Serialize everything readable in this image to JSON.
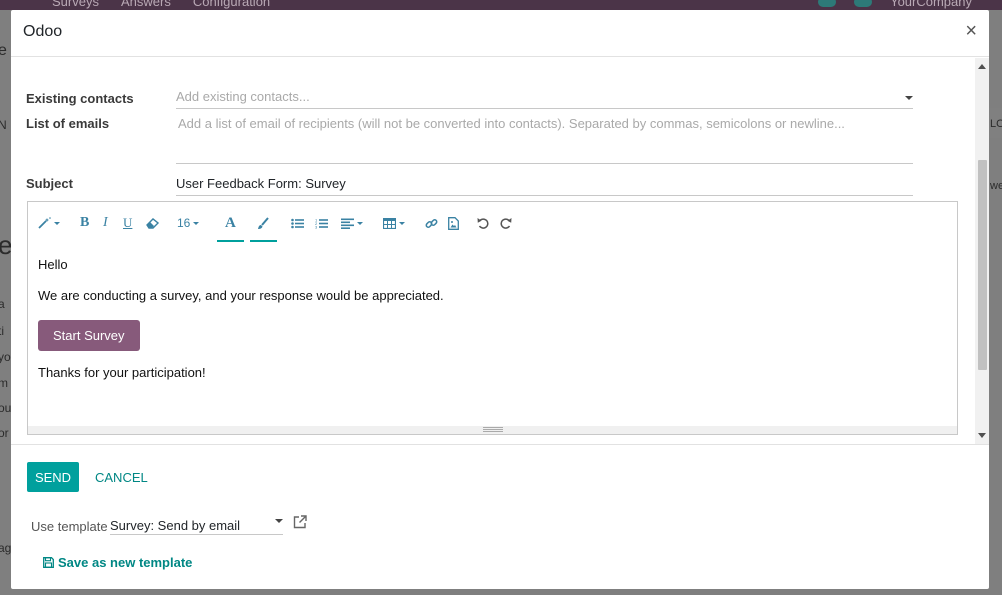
{
  "background": {
    "menu": [
      "Surveys",
      "Answers",
      "Configuration"
    ],
    "company": "YourCompany",
    "left_fragments": [
      "e",
      "N",
      "e",
      "a",
      "ti",
      "yo",
      "m",
      "ou",
      "or",
      "ag"
    ],
    "right_fragments": [
      "LO",
      "we"
    ]
  },
  "dialog": {
    "title": "Odoo",
    "close_glyph": "×"
  },
  "fields": {
    "existing_contacts": {
      "label": "Existing contacts",
      "placeholder": "Add existing contacts..."
    },
    "emails": {
      "label": "List of emails",
      "placeholder": "Add a list of email of recipients (will not be converted into contacts). Separated by commas, semicolons or newline..."
    },
    "subject": {
      "label": "Subject",
      "value": "User Feedback Form: Survey"
    }
  },
  "toolbar": {
    "font_size": "16",
    "font_color_glyph": "A"
  },
  "body": {
    "greeting": "Hello",
    "message": "We are conducting a survey, and your response would be appreciated.",
    "button_label": "Start Survey",
    "closing": "Thanks for your participation!"
  },
  "footer": {
    "send_label": "SEND",
    "cancel_label": "CANCEL",
    "use_template_label": "Use template",
    "template_value": "Survey: Send by email",
    "save_template_label": "Save as new template"
  },
  "colors": {
    "primary": "#00a09d",
    "brand": "#875a7b",
    "toolbar_icon": "#3a82a3"
  }
}
